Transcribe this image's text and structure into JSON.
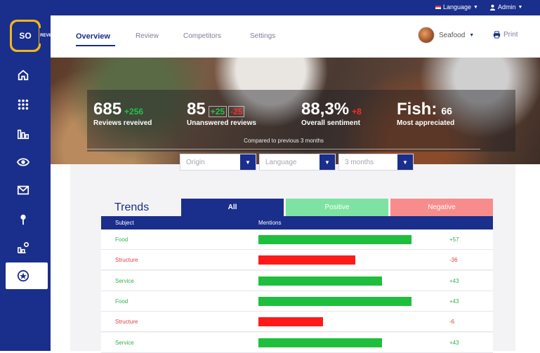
{
  "topbar": {
    "language_label": "Language",
    "admin_label": "Admin"
  },
  "brand": {
    "logo_text": "SO",
    "logo_sub": "REVIEW"
  },
  "nav": {
    "tabs": [
      {
        "label": "Overview",
        "active": true
      },
      {
        "label": "Review",
        "active": false
      },
      {
        "label": "Competitors",
        "active": false
      },
      {
        "label": "Settings",
        "active": false
      }
    ],
    "restaurant": "Seafood",
    "print_label": "Print"
  },
  "sidebar": {
    "icons": [
      "home-icon",
      "grid-icon",
      "bar-chart-icon",
      "eye-icon",
      "mail-icon",
      "pin-icon",
      "stats-search-icon",
      "star-badge-icon"
    ]
  },
  "stats": {
    "reviews": {
      "value": "685",
      "delta": "+256",
      "caption": "Reviews reveived"
    },
    "unanswered": {
      "value": "85",
      "delta_up": "+25",
      "delta_down": "-25",
      "caption": "Unanswered reviews"
    },
    "sentiment": {
      "value": "88,3%",
      "delta": "+8",
      "caption": "Overall sentiment"
    },
    "appreciated": {
      "value": "Fish:",
      "count": "66",
      "caption": "Most appreciated"
    },
    "compared_note": "Compared to previous 3 months"
  },
  "filters": {
    "origin": "Origin",
    "language": "Language",
    "period": "3 months"
  },
  "trends": {
    "title": "Trends",
    "segments": {
      "all": "All",
      "positive": "Positive",
      "negative": "Negative"
    },
    "columns": {
      "subject": "Subject",
      "mentions": "Mentions"
    },
    "colors": {
      "positive": "#1ebf3c",
      "negative": "#ff1a1a"
    },
    "max_mentions": 57,
    "rows": [
      {
        "subject": "Food",
        "value": "+57",
        "mentions": 57,
        "sentiment": "positive"
      },
      {
        "subject": "Structure",
        "value": "-36",
        "mentions": 36,
        "sentiment": "negative"
      },
      {
        "subject": "Service",
        "value": "+43",
        "mentions": 46,
        "sentiment": "positive"
      },
      {
        "subject": "Food",
        "value": "+43",
        "mentions": 57,
        "sentiment": "positive"
      },
      {
        "subject": "Structure",
        "value": "-6",
        "mentions": 24,
        "sentiment": "negative"
      },
      {
        "subject": "Service",
        "value": "+43",
        "mentions": 46,
        "sentiment": "positive"
      }
    ]
  }
}
